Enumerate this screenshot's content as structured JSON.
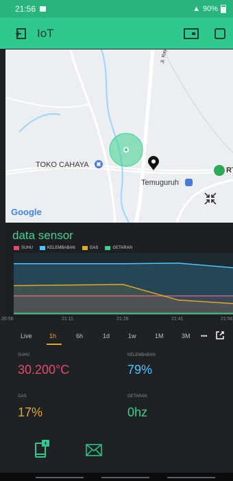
{
  "status": {
    "time": "21:56",
    "right": "90%"
  },
  "app": {
    "title": "IoT"
  },
  "map": {
    "labels": [
      "TOKO CAHAYA",
      "Temuguruh",
      "Jl. Raya To",
      "RT"
    ],
    "google": "Google"
  },
  "sensor": {
    "title": "data sensor",
    "legend": [
      "SUHU",
      "KELEMBABAN",
      "GAS",
      "GETARAN"
    ]
  },
  "chart_data": {
    "type": "line",
    "x": [
      "20:56",
      "21:11",
      "21:26",
      "21:41",
      "21:56"
    ],
    "ylim": [
      0,
      100
    ],
    "series": [
      {
        "name": "SUHU",
        "values": [
          30.2,
          30.2,
          30.2,
          30.2,
          30.2
        ]
      },
      {
        "name": "KELEMBABAN",
        "values": [
          86,
          86,
          86,
          87,
          79
        ]
      },
      {
        "name": "GAS",
        "values": [
          48,
          49,
          50,
          23,
          17
        ]
      },
      {
        "name": "GETARAN",
        "values": [
          0,
          0,
          0,
          0,
          0
        ]
      }
    ]
  },
  "ranges": [
    "Live",
    "1h",
    "6h",
    "1d",
    "1w",
    "1M",
    "3M",
    "•••"
  ],
  "values": {
    "suhu_label": "SUHU",
    "suhu": "30.200°C",
    "kelembaban_label": "KELEMBABAN",
    "kelembaban": "79%",
    "gas_label": "GAS",
    "gas": "17%",
    "getaran_label": "GETARAN",
    "getaran": "0hz"
  },
  "colors": {
    "accent": "#2fc98d",
    "suhu": "#e24b6b",
    "kelembaban": "#4cc5ff",
    "gas": "#e1a829",
    "getaran": "#3ccf8d"
  }
}
